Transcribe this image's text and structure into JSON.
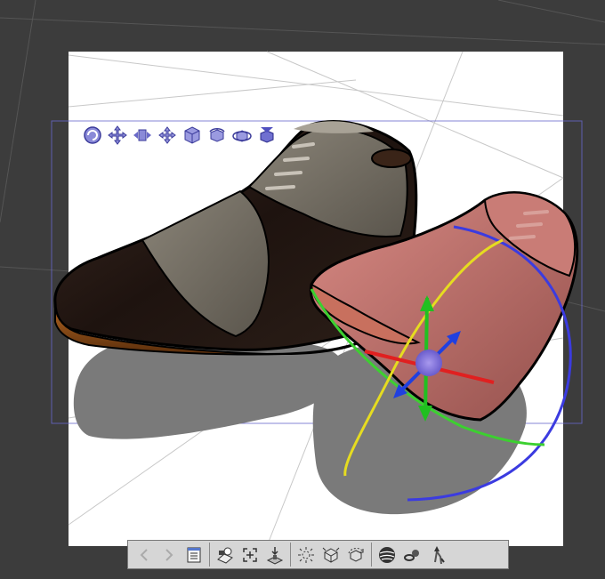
{
  "viewport": {
    "background": "#3c3c3c",
    "canvas_color": "#ffffff",
    "selection_color": "#5555cc"
  },
  "toolbar_3d": {
    "items": [
      {
        "name": "camera-rotate-icon"
      },
      {
        "name": "camera-pan-icon"
      },
      {
        "name": "camera-dolly-icon"
      },
      {
        "name": "object-move-icon"
      },
      {
        "name": "object-move-3d-icon"
      },
      {
        "name": "object-rotate-icon"
      },
      {
        "name": "object-rotate-3d-icon"
      },
      {
        "name": "object-reset-icon"
      }
    ]
  },
  "bottom_toolbar": {
    "groups": [
      [
        {
          "name": "prev-arrow-icon",
          "disabled": true
        },
        {
          "name": "next-arrow-icon",
          "disabled": true
        },
        {
          "name": "object-list-icon",
          "disabled": false
        }
      ],
      [
        {
          "name": "camera-preset-icon",
          "disabled": false
        },
        {
          "name": "fit-to-view-icon",
          "disabled": false
        },
        {
          "name": "ground-drop-icon",
          "disabled": false
        }
      ],
      [
        {
          "name": "light-source-icon",
          "disabled": false
        },
        {
          "name": "object-settings-icon",
          "disabled": false
        },
        {
          "name": "reset-rotation-icon",
          "disabled": false
        }
      ],
      [
        {
          "name": "material-sphere-icon",
          "disabled": false
        },
        {
          "name": "link-icon",
          "disabled": false
        },
        {
          "name": "pose-icon",
          "disabled": false
        }
      ]
    ]
  },
  "manipulator": {
    "x_axis_color": "#e02020",
    "y_axis_color": "#20c020",
    "z_axis_color": "#2040e0",
    "ring_yellow": "#e8e020",
    "center_color": "#8877dd"
  },
  "shoes": [
    {
      "name": "black-oxford-shoe",
      "upper_color": "#231713",
      "panel_color": "#6f6a5f",
      "sole_color": "#8a4a1a"
    },
    {
      "name": "red-oxford-shoe",
      "upper_color": "#b5645f",
      "panel_color": "#a05550",
      "sole_color": "#c46a58"
    }
  ]
}
